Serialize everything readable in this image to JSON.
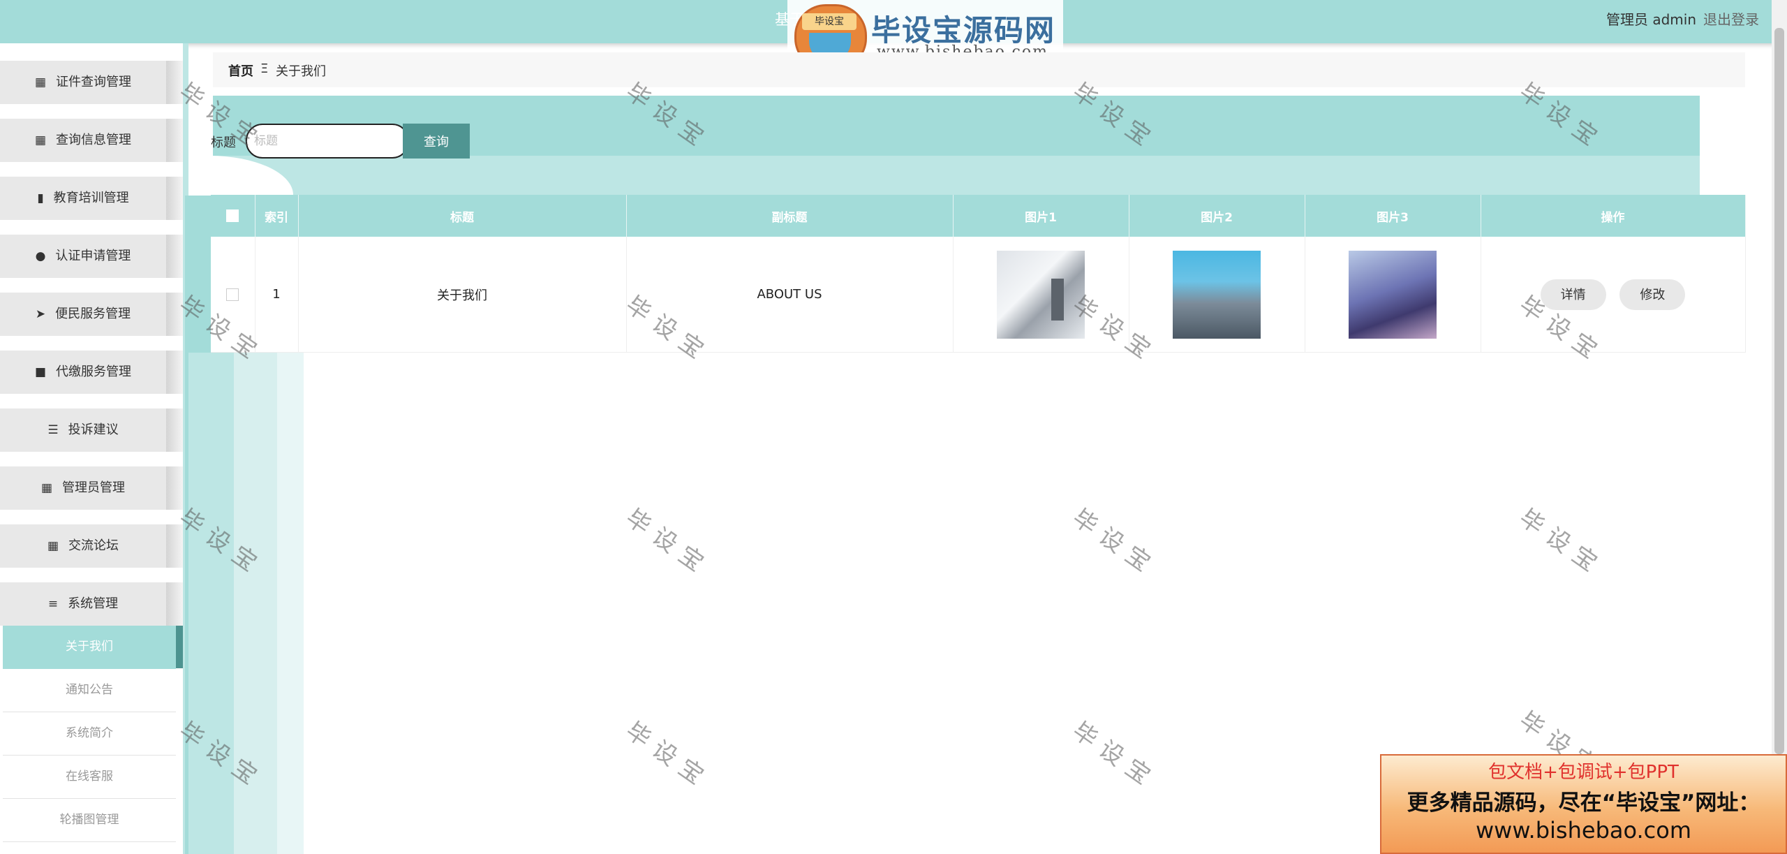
{
  "header": {
    "system_title": "基于...",
    "user_label": "管理员 admin",
    "logout_label": "退出登录"
  },
  "logo_watermark": {
    "badge_text": "毕设宝",
    "name": "毕设宝源码网",
    "site": "www.bishebao.com"
  },
  "sidebar": {
    "items": [
      {
        "label": "证件查询管理",
        "icon": "▦"
      },
      {
        "label": "查询信息管理",
        "icon": "▦"
      },
      {
        "label": "教育培训管理",
        "icon": "▮"
      },
      {
        "label": "认证申请管理",
        "icon": "●"
      },
      {
        "label": "便民服务管理",
        "icon": "➤"
      },
      {
        "label": "代缴服务管理",
        "icon": "■"
      },
      {
        "label": "投诉建议",
        "icon": "☰"
      },
      {
        "label": "管理员管理",
        "icon": "▦"
      },
      {
        "label": "交流论坛",
        "icon": "▦"
      },
      {
        "label": "系统管理",
        "icon": "≡"
      }
    ],
    "submenu": [
      {
        "label": "关于我们"
      },
      {
        "label": "通知公告"
      },
      {
        "label": "系统简介"
      },
      {
        "label": "在线客服"
      },
      {
        "label": "轮播图管理"
      }
    ]
  },
  "breadcrumb": {
    "home": "首页",
    "separator": "Ξ",
    "current": "关于我们"
  },
  "search": {
    "label": "标题",
    "placeholder": "标题",
    "value": "",
    "button": "查询"
  },
  "table": {
    "columns": [
      "索引",
      "标题",
      "副标题",
      "图片1",
      "图片2",
      "图片3",
      "操作"
    ],
    "rows": [
      {
        "index": "1",
        "title": "关于我们",
        "subtitle": "ABOUT US",
        "detail_label": "详情",
        "edit_label": "修改"
      }
    ]
  },
  "watermark_text": "毕设宝",
  "ad_banner": {
    "line1": "包文档+包调试+包PPT",
    "line2": "更多精品源码，尽在“毕设宝”网址：",
    "line3": "www.bishebao.com"
  },
  "colors": {
    "accent": "#a3dcd9",
    "accent_dark": "#4f9592",
    "menu_bg": "#e8e8e8"
  }
}
